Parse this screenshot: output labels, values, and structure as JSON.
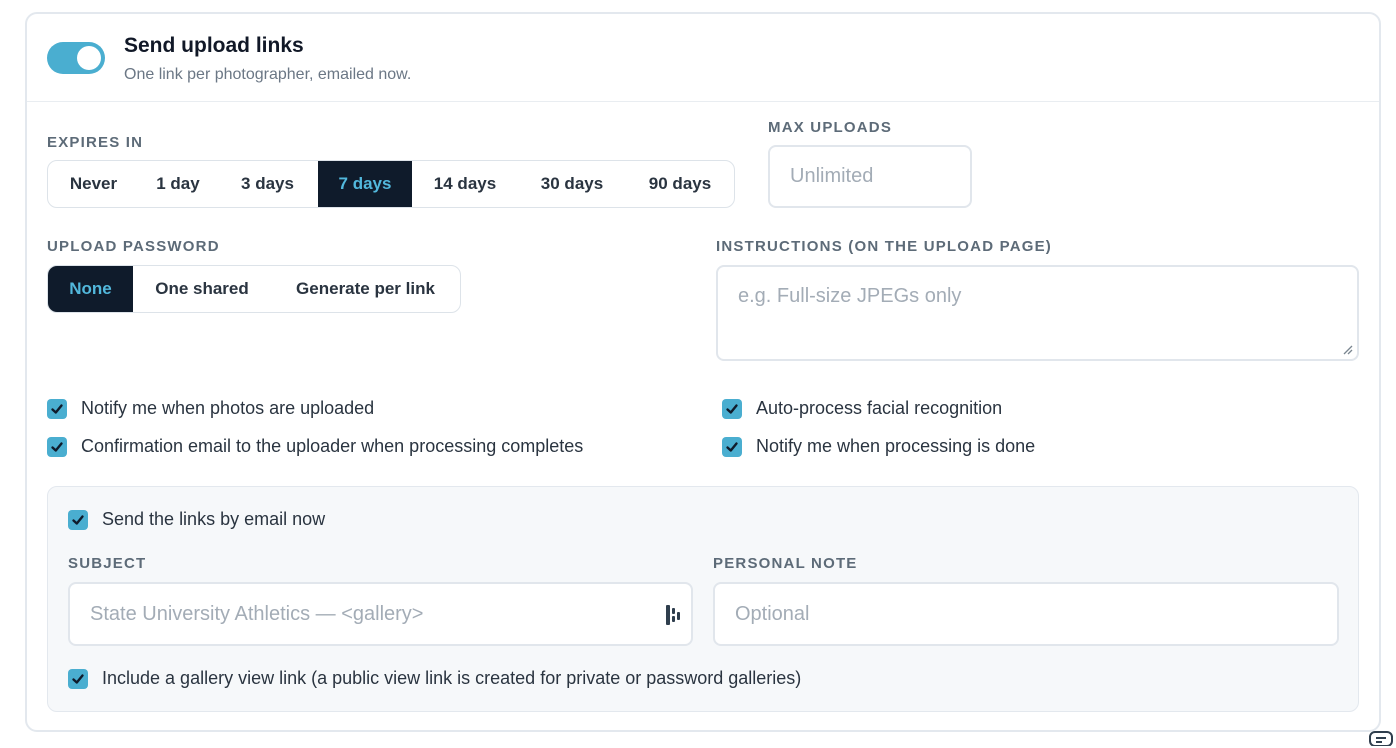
{
  "header": {
    "title": "Send upload links",
    "subtitle": "One link per photographer, emailed now."
  },
  "expires": {
    "label": "EXPIRES IN",
    "options": [
      "Never",
      "1 day",
      "3 days",
      "7 days",
      "14 days",
      "30 days",
      "90 days"
    ],
    "selected": "7 days"
  },
  "max_uploads": {
    "label": "MAX UPLOADS",
    "placeholder": "Unlimited"
  },
  "password": {
    "label": "UPLOAD PASSWORD",
    "options": [
      "None",
      "One shared",
      "Generate per link"
    ],
    "selected": "None"
  },
  "instructions": {
    "label": "INSTRUCTIONS (ON THE UPLOAD PAGE)",
    "placeholder": "e.g. Full-size JPEGs only"
  },
  "checks": {
    "notify_uploaded": "Notify me when photos are uploaded",
    "confirm_email": "Confirmation email to the uploader when processing completes",
    "auto_face": "Auto-process facial recognition",
    "notify_done": "Notify me when processing is done"
  },
  "email": {
    "send_now": "Send the links by email now",
    "subject_label": "SUBJECT",
    "subject_placeholder": "State University Athletics — <gallery>",
    "note_label": "PERSONAL NOTE",
    "note_placeholder": "Optional",
    "include_gallery": "Include a gallery view link (a public view link is created for private or password galleries)"
  },
  "colors": {
    "accent": "#4aaed0",
    "active_bg": "#0f1b2b",
    "active_text": "#52b8dc"
  }
}
